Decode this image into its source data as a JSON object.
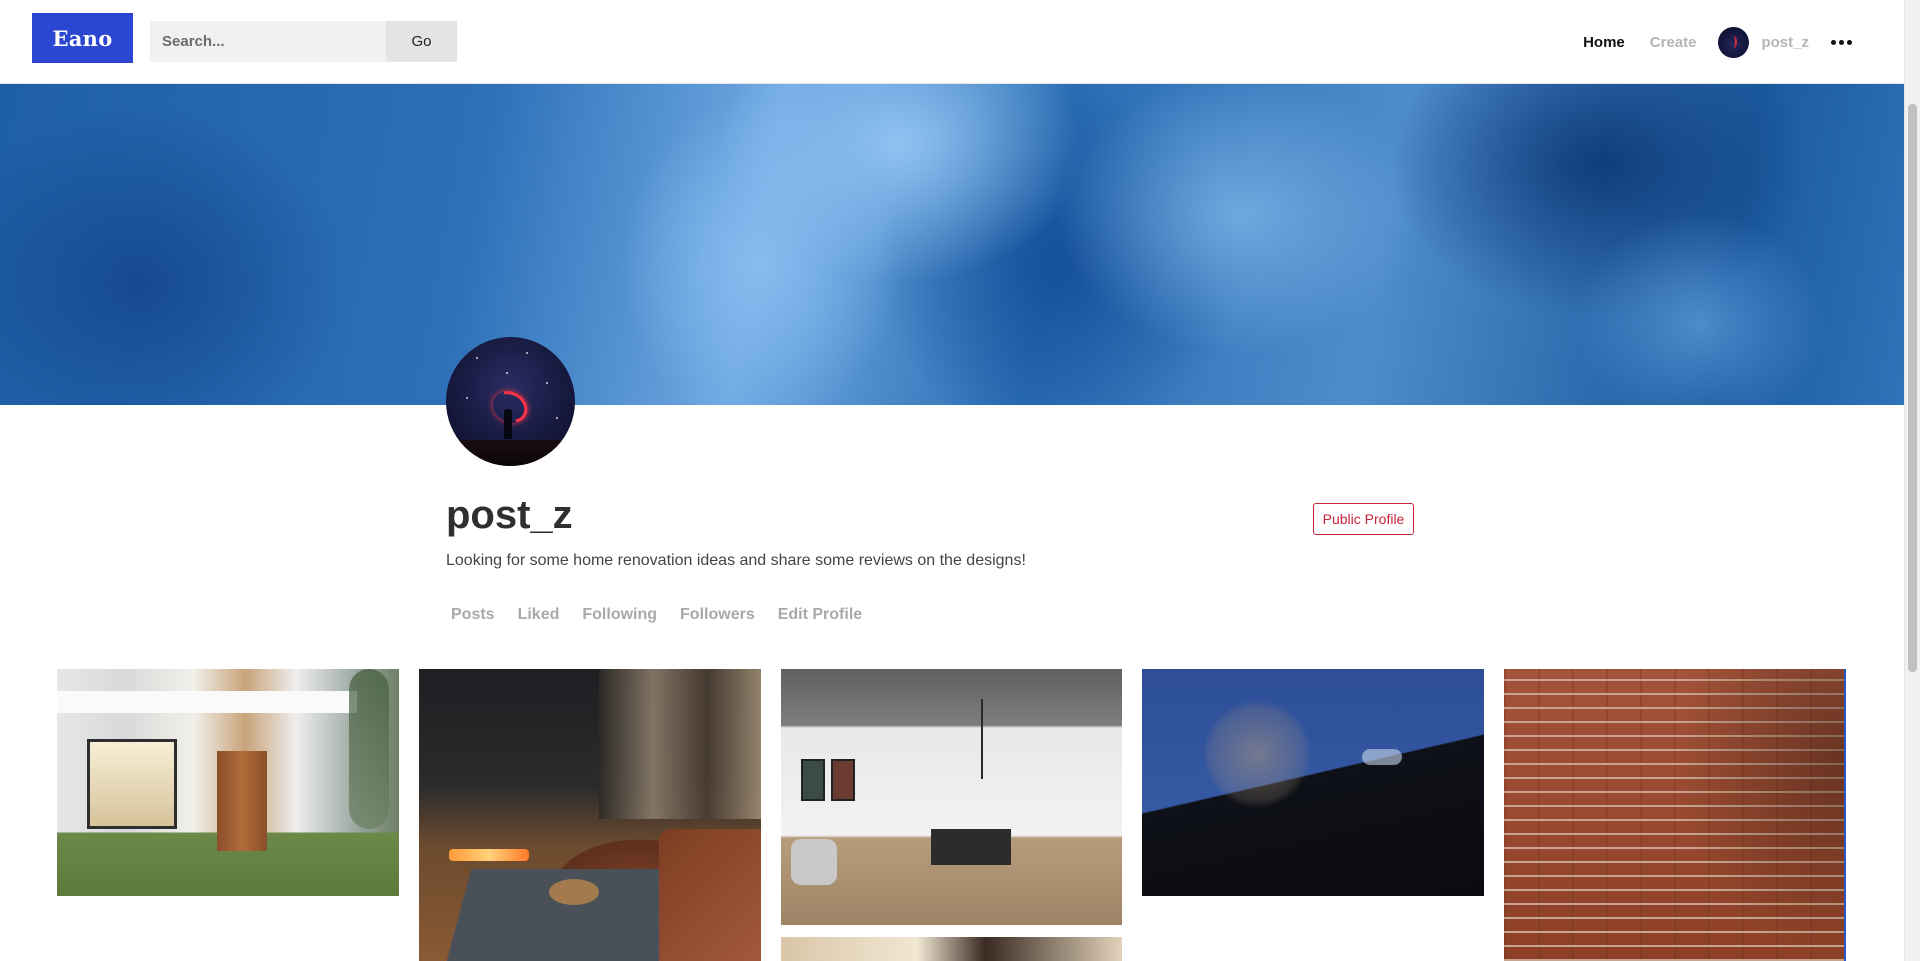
{
  "header": {
    "logo_text": "Eano",
    "search": {
      "placeholder": "Search...",
      "value": ""
    },
    "go_label": "Go",
    "nav": {
      "home_label": "Home",
      "create_label": "Create",
      "username": "post_z",
      "more_icon": "more-horizontal-icon"
    }
  },
  "profile": {
    "name": "post_z",
    "public_profile_label": "Public Profile",
    "bio": "Looking for some home renovation ideas and share some reviews on the designs!",
    "tabs": [
      "Posts",
      "Liked",
      "Following",
      "Followers",
      "Edit Profile"
    ]
  },
  "gallery": {
    "images": [
      "modern-house-exterior",
      "living-room-fireplace",
      "kitchen-dining-interior",
      "interior-room",
      "sky-bare-tree-roof",
      "brick-wall-tree-shadow"
    ]
  },
  "colors": {
    "brand": "#2b47d1",
    "public_profile_accent": "#c8243a",
    "muted_text": "#a9a9a9"
  }
}
